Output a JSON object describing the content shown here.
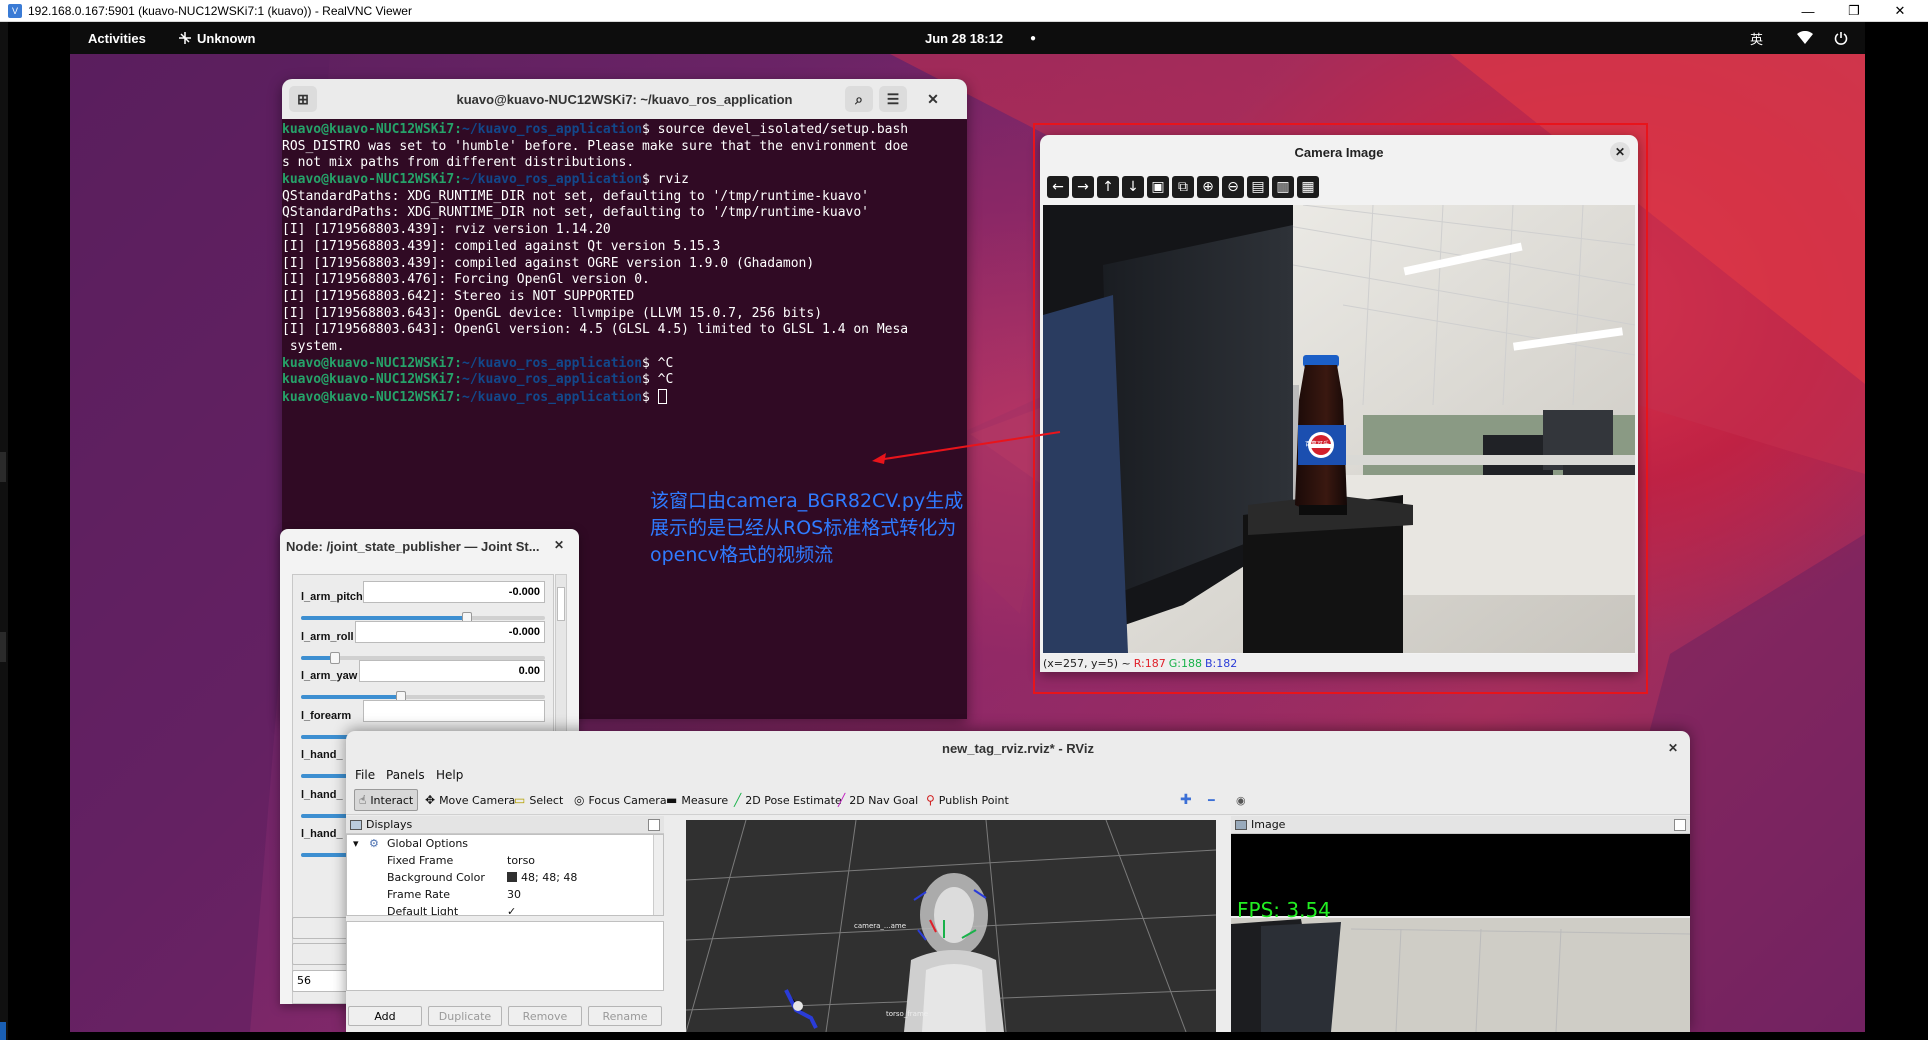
{
  "vnc_window": {
    "title": "192.168.0.167:5901 (kuavo-NUC12WSKi7:1 (kuavo)) - RealVNC Viewer",
    "minimize": "—",
    "maximize": "❐",
    "close": "✕"
  },
  "gnome_bar": {
    "activities": "Activities",
    "network": "Unknown",
    "datetime": "Jun 28  18:12",
    "dot": "●",
    "input_method": "英",
    "wifi_icon": "wifi-icon",
    "power_icon": "power-icon"
  },
  "terminal": {
    "title": "kuavo@kuavo-NUC12WSKi7: ~/kuavo_ros_application",
    "lines": [
      {
        "user": "kuavo@kuavo-NUC12WSKi7:",
        "path": "~/kuavo_ros_application",
        "cmd": "$ source devel_isolated/setup.bash"
      },
      {
        "text": "ROS_DISTRO was set to 'humble' before. Please make sure that the environment doe"
      },
      {
        "text": "s not mix paths from different distributions."
      },
      {
        "user": "kuavo@kuavo-NUC12WSKi7:",
        "path": "~/kuavo_ros_application",
        "cmd": "$ rviz"
      },
      {
        "text": "QStandardPaths: XDG_RUNTIME_DIR not set, defaulting to '/tmp/runtime-kuavo'"
      },
      {
        "text": "QStandardPaths: XDG_RUNTIME_DIR not set, defaulting to '/tmp/runtime-kuavo'"
      },
      {
        "text": "[I] [1719568803.439]: rviz version 1.14.20"
      },
      {
        "text": "[I] [1719568803.439]: compiled against Qt version 5.15.3"
      },
      {
        "text": "[I] [1719568803.439]: compiled against OGRE version 1.9.0 (Ghadamon)"
      },
      {
        "text": "[I] [1719568803.476]: Forcing OpenGl version 0."
      },
      {
        "text": "[I] [1719568803.642]: Stereo is NOT SUPPORTED"
      },
      {
        "text": "[I] [1719568803.643]: OpenGL device: llvmpipe (LLVM 15.0.7, 256 bits)"
      },
      {
        "text": "[I] [1719568803.643]: OpenGl version: 4.5 (GLSL 4.5) limited to GLSL 1.4 on Mesa"
      },
      {
        "text": " system."
      },
      {
        "user": "kuavo@kuavo-NUC12WSKi7:",
        "path": "~/kuavo_ros_application",
        "cmd": "$ ^C"
      },
      {
        "user": "kuavo@kuavo-NUC12WSKi7:",
        "path": "~/kuavo_ros_application",
        "cmd": "$ ^C"
      },
      {
        "user": "kuavo@kuavo-NUC12WSKi7:",
        "path": "~/kuavo_ros_application",
        "cmd": "$ ",
        "cursor": true
      }
    ]
  },
  "camera_window": {
    "title": "Camera Image",
    "close": "✕",
    "tools": [
      {
        "name": "back-icon",
        "glyph": "←"
      },
      {
        "name": "forward-icon",
        "glyph": "→"
      },
      {
        "name": "up-icon",
        "glyph": "↑"
      },
      {
        "name": "down-icon",
        "glyph": "↓"
      },
      {
        "name": "fit-icon",
        "glyph": "▣"
      },
      {
        "name": "image-icon",
        "glyph": "⧉"
      },
      {
        "name": "zoom-in-icon",
        "glyph": "⊕"
      },
      {
        "name": "zoom-out-icon",
        "glyph": "⊖"
      },
      {
        "name": "save-icon",
        "glyph": "▤"
      },
      {
        "name": "clipboard-icon",
        "glyph": "▥"
      },
      {
        "name": "properties-icon",
        "glyph": "▦"
      }
    ],
    "status": {
      "coords": "(x=257, y=5) ~",
      "r": "R:187",
      "g": "G:188",
      "b": "B:182"
    },
    "bottle_label": "百事可乐"
  },
  "annotation": {
    "line1": "该窗口由camera_BGR82CV.py生成",
    "line2": "展示的是已经从ROS标准格式转化为",
    "line3": "opencv格式的视频流",
    "color": "#2f7bff"
  },
  "joint_publisher": {
    "title": "Node: /joint_state_publisher — Joint St...",
    "close": "✕",
    "joints": [
      {
        "name": "l_arm_pitch",
        "value": "-0.000",
        "level": 0.68
      },
      {
        "name": "l_arm_roll",
        "value": "-0.000",
        "level": 0.14
      },
      {
        "name": "l_arm_yaw",
        "value": "0.00",
        "level": 0.41
      },
      {
        "name": "l_forearm",
        "value": "",
        "level": 0.5
      },
      {
        "name": "l_hand_",
        "value": "",
        "level": 0.5
      },
      {
        "name": "l_hand_",
        "value": "",
        "level": 0.5
      },
      {
        "name": "l_hand_",
        "value": "",
        "level": 0.5
      }
    ],
    "field_value": "56"
  },
  "rviz": {
    "title": "new_tag_rviz.rviz* - RViz",
    "close": "✕",
    "menu": {
      "file": "File",
      "panels": "Panels",
      "help": "Help"
    },
    "tools": [
      {
        "label": "Interact",
        "icon": "hand-icon",
        "glyph": "☝",
        "active": true
      },
      {
        "label": "Move Camera",
        "icon": "move-camera-icon",
        "glyph": "✥"
      },
      {
        "label": "Select",
        "icon": "select-icon",
        "glyph": "▭"
      },
      {
        "label": "Focus Camera",
        "icon": "focus-camera-icon",
        "glyph": "◎"
      },
      {
        "label": "Measure",
        "icon": "measure-icon",
        "glyph": "▬"
      },
      {
        "label": "2D Pose Estimate",
        "icon": "pose-estimate-icon",
        "glyph": "╱"
      },
      {
        "label": "2D Nav Goal",
        "icon": "nav-goal-icon",
        "glyph": "╱"
      },
      {
        "label": "Publish Point",
        "icon": "publish-point-icon",
        "glyph": "⚲"
      }
    ],
    "view_tools": {
      "plus": "✚",
      "minus": "━",
      "eye": "◉"
    },
    "displays": {
      "title": "Displays",
      "rows": [
        {
          "label": "Global Options",
          "value": ""
        },
        {
          "label": "Fixed Frame",
          "value": "torso"
        },
        {
          "label": "Background Color",
          "value": "48; 48; 48"
        },
        {
          "label": "Frame Rate",
          "value": "30"
        },
        {
          "label": "Default Light",
          "value": "✓"
        }
      ],
      "buttons": {
        "add": "Add",
        "duplicate": "Duplicate",
        "remove": "Remove",
        "rename": "Rename"
      }
    },
    "view3d_labels": {
      "camera": "camera_...ame",
      "torso": "torso_frame"
    },
    "image_panel": {
      "title": "Image",
      "fps": "FPS:  3.54"
    }
  }
}
